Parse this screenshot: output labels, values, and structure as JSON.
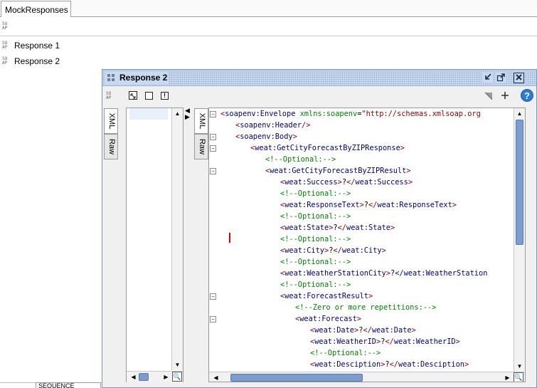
{
  "tabs": [
    {
      "label": "MockResponses"
    }
  ],
  "toolbar": {
    "icon": "soap-icon"
  },
  "list": {
    "items": [
      {
        "label": "Response 1"
      },
      {
        "label": "Response 2"
      }
    ]
  },
  "window": {
    "title": "Response 2",
    "controls": [
      "dock-icon",
      "maximize-icon",
      "close-icon"
    ],
    "help_label": "?",
    "left_tabs": [
      {
        "label": "XML"
      },
      {
        "label": "Raw"
      }
    ],
    "right_tabs": [
      {
        "label": "XML"
      },
      {
        "label": "Raw"
      }
    ]
  },
  "xml_lines": [
    {
      "indent": 0,
      "kind": "open-attr",
      "name": "soapenv:Envelope",
      "attr": "xmlns:soapenv",
      "value": "\"http://schemas.xmlsoap.org"
    },
    {
      "indent": 1,
      "kind": "self",
      "name": "soapenv:Header"
    },
    {
      "indent": 1,
      "kind": "open",
      "name": "soapenv:Body"
    },
    {
      "indent": 2,
      "kind": "open",
      "name": "weat:GetCityForecastByZIPResponse"
    },
    {
      "indent": 3,
      "kind": "comment",
      "text": "<!--Optional:-->"
    },
    {
      "indent": 3,
      "kind": "open",
      "name": "weat:GetCityForecastByZIPResult"
    },
    {
      "indent": 4,
      "kind": "elem",
      "name": "weat:Success",
      "text": "?"
    },
    {
      "indent": 4,
      "kind": "comment",
      "text": "<!--Optional:-->"
    },
    {
      "indent": 4,
      "kind": "elem",
      "name": "weat:ResponseText",
      "text": "?"
    },
    {
      "indent": 4,
      "kind": "comment",
      "text": "<!--Optional:-->"
    },
    {
      "indent": 4,
      "kind": "elem",
      "name": "weat:State",
      "text": "?"
    },
    {
      "indent": 4,
      "kind": "comment",
      "text": "<!--Optional:-->"
    },
    {
      "indent": 4,
      "kind": "elem",
      "name": "weat:City",
      "text": "?"
    },
    {
      "indent": 4,
      "kind": "comment",
      "text": "<!--Optional:-->"
    },
    {
      "indent": 4,
      "kind": "elem",
      "name": "weat:WeatherStationCity",
      "text": "?",
      "close": "</weat:WeatherStation"
    },
    {
      "indent": 4,
      "kind": "comment",
      "text": "<!--Optional:-->"
    },
    {
      "indent": 4,
      "kind": "open",
      "name": "weat:ForecastResult"
    },
    {
      "indent": 5,
      "kind": "comment",
      "text": "<!--Zero or more repetitions:-->"
    },
    {
      "indent": 5,
      "kind": "open",
      "name": "weat:Forecast"
    },
    {
      "indent": 6,
      "kind": "elem",
      "name": "weat:Date",
      "text": "?"
    },
    {
      "indent": 6,
      "kind": "elem",
      "name": "weat:WeatherID",
      "text": "?"
    },
    {
      "indent": 6,
      "kind": "comment",
      "text": "<!--Optional:-->"
    },
    {
      "indent": 6,
      "kind": "elem",
      "name": "weat:Desciption",
      "text": "?"
    }
  ],
  "fold_markers": [
    0,
    2,
    3,
    5,
    16,
    18
  ],
  "bottom": {
    "label": "...",
    "field": "SEQUENCE"
  },
  "colors": {
    "title_bar": "#c9d9ef",
    "scroll_thumb": "#7b9ccc",
    "caret": "#e00000"
  }
}
